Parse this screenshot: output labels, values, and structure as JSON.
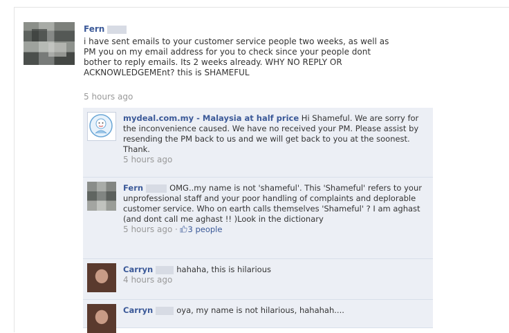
{
  "post": {
    "author": "Fern",
    "text": "i have sent emails to your customer service people two weeks, as well as\nPM you on my email address for you to check since your people dont\nbother to reply emails. Its 2 weeks already. WHY NO REPLY OR\nACKNOWLEDGEMEnt? this is SHAMEFUL",
    "time": "5 hours ago"
  },
  "comments": [
    {
      "author": "mydeal.com.my - Malaysia at half price",
      "text": "Hi Shameful. We are sorry for the inconvenience caused. We have no received your PM. Please assist by resending the PM back to us and we will get back to you at the soonest. Thank.",
      "time": "5 hours ago"
    },
    {
      "author": "Fern",
      "text": "OMG..my name is not 'shameful'. This 'Shameful' refers to your unprofessional staff and your poor handling of complaints and deplorable customer service. Who on earth calls themselves 'Shameful' ? I am aghast (and dont call me aghast !! )Look in the dictionary",
      "time": "5 hours ago",
      "separator": "·",
      "like_icon": "thumbs-up-icon",
      "likes": "3 people"
    },
    {
      "author": "Carryn",
      "text": "hahaha, this is hilarious",
      "time": "4 hours ago"
    },
    {
      "author": "Carryn",
      "text": "oya, my name is not hilarious, hahahah....",
      "time": ""
    }
  ]
}
